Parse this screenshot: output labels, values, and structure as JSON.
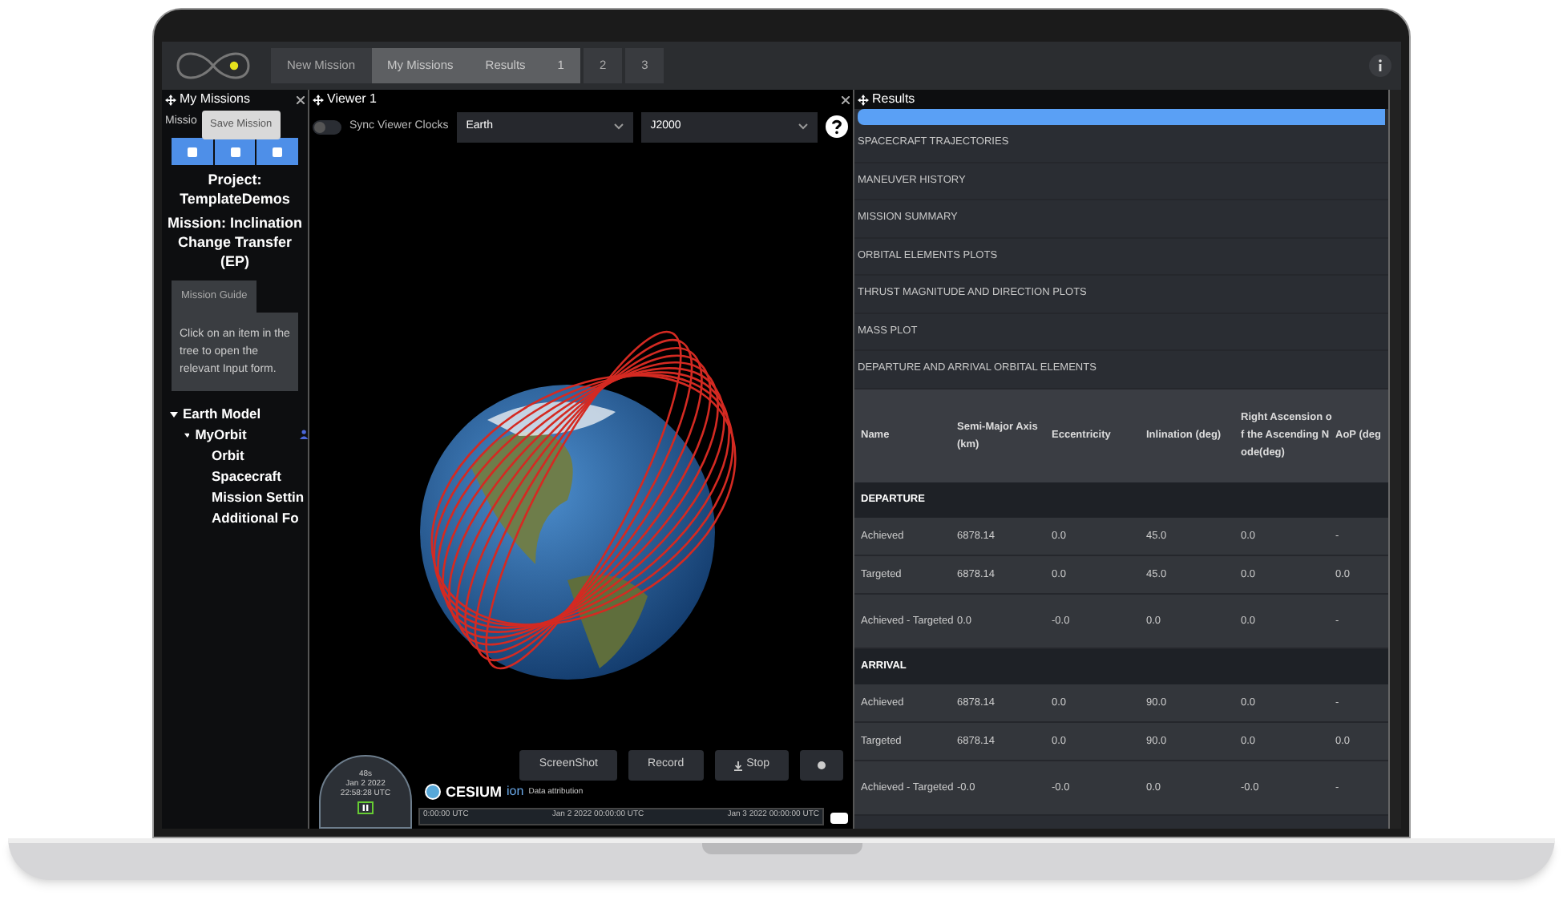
{
  "topbar": {
    "tabs": [
      {
        "label": "New Mission",
        "selected": false
      },
      {
        "label": "My Missions",
        "selected": true
      },
      {
        "label": "Results",
        "selected": true
      },
      {
        "label": "1",
        "selected": true
      },
      {
        "label": "2",
        "selected": false
      },
      {
        "label": "3",
        "selected": false
      }
    ]
  },
  "left_panel": {
    "title": "My Missions",
    "cut_label": "Missio",
    "tooltip": "Save Mission",
    "project": "Project: TemplateDemos",
    "mission": "Mission: Inclination Change Transfer (EP)",
    "guide_tab": "Mission Guide",
    "guide_text": "Click on an item in the tree to open the relevant Input form.",
    "tree": [
      {
        "label": "Earth Model",
        "expanded": true,
        "children": [
          {
            "label": "MyOrbit",
            "expanded": true,
            "children": [
              {
                "label": "Orbit"
              },
              {
                "label": "Spacecraft"
              },
              {
                "label": "Mission Settin"
              },
              {
                "label": "Additional Fo"
              }
            ]
          }
        ]
      }
    ]
  },
  "viewer": {
    "title": "Viewer 1",
    "sync": {
      "label": "Sync Viewer Clocks",
      "on": false
    },
    "selects": [
      {
        "value": "Earth"
      },
      {
        "value": "J2000"
      }
    ],
    "buttons": [
      {
        "label": "ScreenShot",
        "kind": "text"
      },
      {
        "label": "Record",
        "kind": "text"
      },
      {
        "label": "Stop",
        "kind": "stop"
      }
    ],
    "clock": {
      "speed": "48s",
      "date": "Jan 2 2022",
      "time": "22:58:28 UTC"
    },
    "cesium": {
      "brand": "CESIUM",
      "suffix": "ion",
      "attribution": "Data attribution"
    },
    "timeline": [
      "0:00:00 UTC",
      "Jan 2 2022 00:00:00 UTC",
      "Jan 3 2022 00:00:00 UTC"
    ]
  },
  "results": {
    "title": "Results",
    "progress": {
      "level": 1
    },
    "items": [
      "SPACECRAFT TRAJECTORIES",
      "MANEUVER HISTORY",
      "MISSION SUMMARY",
      "ORBITAL ELEMENTS PLOTS",
      "THRUST MAGNITUDE AND DIRECTION PLOTS",
      "MASS PLOT",
      "DEPARTURE AND ARRIVAL ORBITAL ELEMENTS"
    ],
    "table": {
      "columns": [
        "Name",
        "Semi-Major Axis (km)",
        "Eccentricity",
        "Inlination (deg)",
        "Right Ascension of the Ascending Node(deg)",
        "AoP (deg"
      ],
      "sections": [
        {
          "title": "DEPARTURE",
          "rows": [
            [
              "Achieved",
              "6878.14",
              "0.0",
              "45.0",
              "0.0",
              "-"
            ],
            [
              "Targeted",
              "6878.14",
              "0.0",
              "45.0",
              "0.0",
              "0.0"
            ],
            [
              "Achieved - Targeted",
              "0.0",
              "-0.0",
              "0.0",
              "0.0",
              "-"
            ]
          ]
        },
        {
          "title": "ARRIVAL",
          "rows": [
            [
              "Achieved",
              "6878.14",
              "0.0",
              "90.0",
              "0.0",
              "-"
            ],
            [
              "Targeted",
              "6878.14",
              "0.0",
              "90.0",
              "0.0",
              "0.0"
            ],
            [
              "Achieved - Targeted",
              "-0.0",
              "-0.0",
              "0.0",
              "-0.0",
              "-"
            ]
          ]
        }
      ]
    }
  }
}
